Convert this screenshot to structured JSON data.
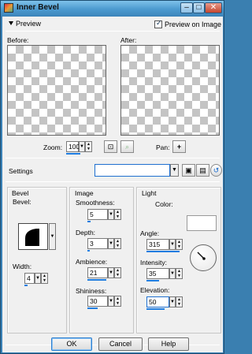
{
  "window": {
    "title": "Inner Bevel",
    "min_icon": "minimize-icon",
    "max_icon": "maximize-icon",
    "close_icon": "close-icon"
  },
  "preview": {
    "toggle_label": "Preview",
    "preview_on_image_label": "Preview on Image",
    "preview_on_image_checked": true,
    "before_label": "Before:",
    "after_label": "After:",
    "zoom_label": "Zoom:",
    "zoom_value": "100",
    "pan_label": "Pan:",
    "pan_icon": "+"
  },
  "settings": {
    "label": "Settings",
    "value": ""
  },
  "bevel": {
    "group_label": "Bevel",
    "bevel_label": "Bevel:",
    "width_label": "Width:",
    "width_value": "4"
  },
  "image": {
    "group_label": "Image",
    "smoothness_label": "Smoothness:",
    "smoothness_value": "5",
    "depth_label": "Depth:",
    "depth_value": "3",
    "ambience_label": "Ambience:",
    "ambience_value": "21",
    "shininess_label": "Shininess:",
    "shininess_value": "30"
  },
  "light": {
    "group_label": "Light",
    "color_label": "Color:",
    "color_value": "#ffffff",
    "angle_label": "Angle:",
    "angle_value": "315",
    "intensity_label": "Intensity:",
    "intensity_value": "35",
    "elevation_label": "Elevation:",
    "elevation_value": "50"
  },
  "buttons": {
    "ok": "OK",
    "cancel": "Cancel",
    "help": "Help"
  },
  "colors": {
    "accent": "#1f7de0",
    "title_bar": "#4d9bd0",
    "close": "#c5452e"
  }
}
